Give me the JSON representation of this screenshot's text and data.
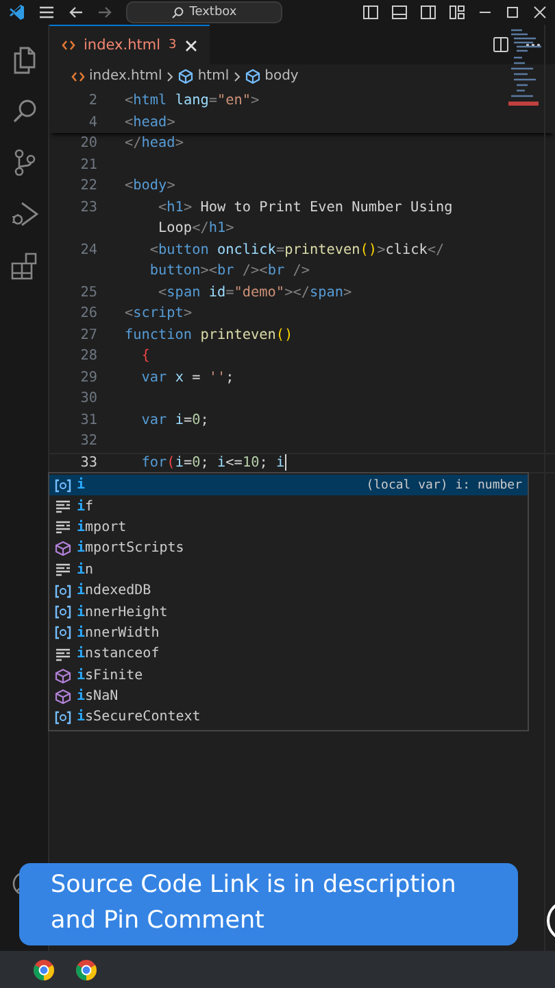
{
  "title_bar": {
    "search": "Textbox"
  },
  "tab": {
    "label": "index.html",
    "badge": "3",
    "selected": true
  },
  "breadcrumb": [
    "index.html",
    "html",
    "body"
  ],
  "lines": [
    {
      "number": "2",
      "current": false,
      "tokens": [
        {
          "kind": "punct",
          "text": "<"
        },
        {
          "kind": "tag",
          "text": "html"
        },
        {
          "kind": "attr",
          "text": " lang"
        },
        {
          "kind": "punct",
          "text": "="
        },
        {
          "kind": "string",
          "text": "\"en\""
        },
        {
          "kind": "punct",
          "text": ">"
        }
      ]
    },
    {
      "number": "4",
      "current": false,
      "tokens": [
        {
          "kind": "punct",
          "text": "<"
        },
        {
          "kind": "tag",
          "text": "head"
        },
        {
          "kind": "punct",
          "text": ">"
        }
      ]
    },
    {
      "number": "20",
      "current": false,
      "tokens": [
        {
          "kind": "punct",
          "text": "</"
        },
        {
          "kind": "tag",
          "text": "head"
        },
        {
          "kind": "punct",
          "text": ">"
        }
      ]
    },
    {
      "number": "21",
      "current": false
    },
    {
      "number": "22",
      "current": false,
      "tokens": [
        {
          "kind": "punct",
          "text": "<"
        },
        {
          "kind": "tag",
          "text": "body"
        },
        {
          "kind": "punct",
          "text": ">"
        }
      ]
    },
    {
      "number": "23",
      "current": false,
      "tokens": [
        {
          "kind": "punct",
          "text": "    <"
        },
        {
          "kind": "tag",
          "text": "h1"
        },
        {
          "kind": "punct",
          "text": ">"
        },
        {
          "kind": "text",
          "text": " How to Print Even Number Using"
        }
      ]
    },
    {
      "current": false,
      "tokens": [
        {
          "kind": "text",
          "text": "    Loop"
        },
        {
          "kind": "punct",
          "text": "</"
        },
        {
          "kind": "tag",
          "text": "h1"
        },
        {
          "kind": "punct",
          "text": ">"
        }
      ]
    },
    {
      "number": "24",
      "current": false,
      "tokens": [
        {
          "kind": "punct",
          "text": "   <"
        },
        {
          "kind": "tag",
          "text": "button"
        },
        {
          "kind": "attr",
          "text": " onclick"
        },
        {
          "kind": "punct",
          "text": "="
        },
        {
          "kind": "func",
          "text": "printeven"
        },
        {
          "kind": "bracket",
          "text": "()"
        },
        {
          "kind": "punct",
          "text": ">"
        },
        {
          "kind": "text",
          "text": "click"
        },
        {
          "kind": "punct",
          "text": "</"
        }
      ]
    },
    {
      "current": false,
      "tokens": [
        {
          "kind": "tag",
          "text": "   button"
        },
        {
          "kind": "punct",
          "text": "><"
        },
        {
          "kind": "tag",
          "text": "br"
        },
        {
          "kind": "punct",
          "text": " /><"
        },
        {
          "kind": "tag",
          "text": "br"
        },
        {
          "kind": "punct",
          "text": " />"
        }
      ]
    },
    {
      "number": "25",
      "current": false,
      "tokens": [
        {
          "kind": "punct",
          "text": "    <"
        },
        {
          "kind": "tag",
          "text": "span"
        },
        {
          "kind": "attr",
          "text": " id"
        },
        {
          "kind": "punct",
          "text": "="
        },
        {
          "kind": "string",
          "text": "\"demo\""
        },
        {
          "kind": "punct",
          "text": "></"
        },
        {
          "kind": "tag",
          "text": "span"
        },
        {
          "kind": "punct",
          "text": ">"
        }
      ]
    },
    {
      "number": "26",
      "current": false,
      "tokens": [
        {
          "kind": "punct",
          "text": "<"
        },
        {
          "kind": "tag",
          "text": "script"
        },
        {
          "kind": "punct",
          "text": ">"
        }
      ]
    },
    {
      "number": "27",
      "current": false,
      "tokens": [
        {
          "kind": "keyword",
          "text": "function "
        },
        {
          "kind": "func",
          "text": "printeven"
        },
        {
          "kind": "bracket",
          "text": "()"
        }
      ]
    },
    {
      "number": "28",
      "current": false,
      "tokens": [
        {
          "kind": "error",
          "text": "  {"
        }
      ]
    },
    {
      "number": "29",
      "current": false,
      "tokens": [
        {
          "kind": "keyword",
          "text": "  var "
        },
        {
          "kind": "var",
          "text": "x"
        },
        {
          "kind": "text",
          "text": " = "
        },
        {
          "kind": "string",
          "text": "''"
        },
        {
          "kind": "text",
          "text": ";"
        }
      ]
    },
    {
      "number": "30",
      "current": false
    },
    {
      "number": "31",
      "current": false,
      "tokens": [
        {
          "kind": "keyword",
          "text": "  var "
        },
        {
          "kind": "var",
          "text": "i"
        },
        {
          "kind": "text",
          "text": "="
        },
        {
          "kind": "number",
          "text": "0"
        },
        {
          "kind": "text",
          "text": ";"
        }
      ]
    },
    {
      "number": "32",
      "current": false
    },
    {
      "number": "33",
      "current": true,
      "tokens": [
        {
          "kind": "keyword",
          "text": "  for"
        },
        {
          "kind": "error",
          "text": "("
        },
        {
          "kind": "var",
          "text": "i"
        },
        {
          "kind": "text",
          "text": "="
        },
        {
          "kind": "number",
          "text": "0"
        },
        {
          "kind": "text",
          "text": "; "
        },
        {
          "kind": "var",
          "text": "i"
        },
        {
          "kind": "text",
          "text": "<="
        },
        {
          "kind": "number",
          "text": "10"
        },
        {
          "kind": "text",
          "text": "; "
        },
        {
          "kind": "var",
          "text": "i"
        }
      ]
    }
  ],
  "suggestions": [
    {
      "kind": "variable",
      "match": "i",
      "selected": true,
      "detail": "(local var) i: number"
    },
    {
      "kind": "keyword",
      "match": "i",
      "rest": "f",
      "selected": false
    },
    {
      "kind": "keyword",
      "match": "i",
      "rest": "mport",
      "selected": false
    },
    {
      "kind": "method",
      "match": "i",
      "rest": "mportScripts",
      "selected": false
    },
    {
      "kind": "keyword",
      "match": "i",
      "rest": "n",
      "selected": false
    },
    {
      "kind": "variable",
      "match": "i",
      "rest": "ndexedDB",
      "selected": false
    },
    {
      "kind": "variable",
      "match": "i",
      "rest": "nnerHeight",
      "selected": false
    },
    {
      "kind": "variable",
      "match": "i",
      "rest": "nnerWidth",
      "selected": false
    },
    {
      "kind": "keyword",
      "match": "i",
      "rest": "nstanceof",
      "selected": false
    },
    {
      "kind": "method",
      "match": "i",
      "rest": "sFinite",
      "selected": false
    },
    {
      "kind": "method",
      "match": "i",
      "rest": "sNaN",
      "selected": false
    },
    {
      "kind": "variable",
      "match": "i",
      "rest": "sSecureContext",
      "selected": false
    }
  ],
  "caption": "Source Code Link is in description and Pin Comment"
}
